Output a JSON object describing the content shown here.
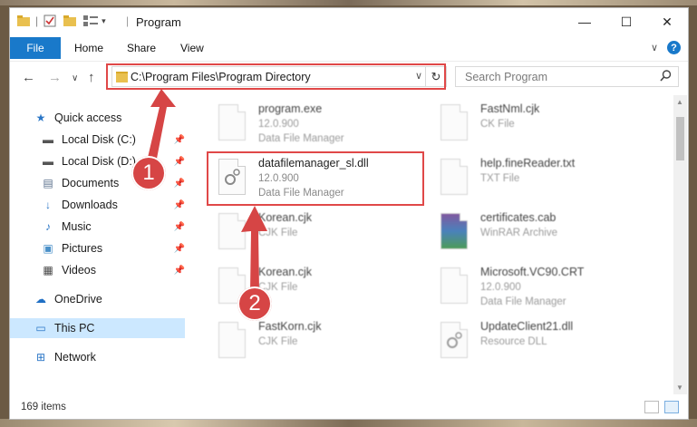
{
  "window": {
    "title": "Program",
    "qa_separator": "|",
    "buttons": {
      "minimize": "—",
      "maximize": "☐",
      "close": "✕"
    }
  },
  "ribbon": {
    "tabs": [
      "File",
      "Home",
      "Share",
      "View"
    ],
    "expand_icon": "∨",
    "help_icon": "?"
  },
  "address_bar": {
    "path": "C:\\Program Files\\Program Directory",
    "dropdown_icon": "∨",
    "refresh_icon": "↻"
  },
  "nav": {
    "back": "←",
    "forward": "→",
    "recent": "∨",
    "up": "↑"
  },
  "search": {
    "placeholder": "Search Program",
    "icon": "search-icon"
  },
  "sidebar": {
    "items": [
      {
        "label": "Quick access",
        "icon": "star-icon",
        "pinned": false
      },
      {
        "label": "Local Disk (C:)",
        "icon": "drive-icon",
        "pinned": true
      },
      {
        "label": "Local Disk (D:)",
        "icon": "drive-icon",
        "pinned": true
      },
      {
        "label": "Documents",
        "icon": "documents-icon",
        "pinned": true
      },
      {
        "label": "Downloads",
        "icon": "downloads-icon",
        "pinned": true
      },
      {
        "label": "Music",
        "icon": "music-icon",
        "pinned": true
      },
      {
        "label": "Pictures",
        "icon": "pictures-icon",
        "pinned": true
      },
      {
        "label": "Videos",
        "icon": "videos-icon",
        "pinned": true
      },
      {
        "label": "OneDrive",
        "icon": "cloud-icon",
        "pinned": false
      },
      {
        "label": "This PC",
        "icon": "computer-icon",
        "pinned": false,
        "selected": true
      },
      {
        "label": "Network",
        "icon": "network-icon",
        "pinned": false
      }
    ],
    "pin_glyph": "📌"
  },
  "files": [
    {
      "name": "program.exe",
      "line2": "12.0.900",
      "line3": "Data File Manager",
      "blurred": true
    },
    {
      "name": "FastNml.cjk",
      "line2": "CK File",
      "line3": "",
      "blurred": true
    },
    {
      "name": "datafilemanager_sl.dll",
      "line2": "12.0.900",
      "line3": "Data File Manager",
      "blurred": false
    },
    {
      "name": "help.fineReader.txt",
      "line2": "TXT File",
      "line3": "",
      "blurred": true
    },
    {
      "name": "Korean.cjk",
      "line2": "CJK File",
      "line3": "",
      "blurred": true
    },
    {
      "name": "certificates.cab",
      "line2": "WinRAR Archive",
      "line3": "",
      "blurred": true
    },
    {
      "name": "Korean.cjk",
      "line2": "CJK File",
      "line3": "",
      "blurred": true
    },
    {
      "name": "Microsoft.VC90.CRT",
      "line2": "12.0.900",
      "line3": "Data File Manager",
      "blurred": true
    },
    {
      "name": "FastKorn.cjk",
      "line2": "CJK File",
      "line3": "",
      "blurred": true
    },
    {
      "name": "UpdateClient21.dll",
      "line2": "Resource DLL",
      "line3": "",
      "blurred": true
    }
  ],
  "status": {
    "item_count": "169 items"
  },
  "annotations": {
    "badge_1": "1",
    "badge_2": "2",
    "highlight_color": "#e04848"
  },
  "colors": {
    "accent": "#1979ca",
    "selected_bg": "#cce8ff"
  }
}
